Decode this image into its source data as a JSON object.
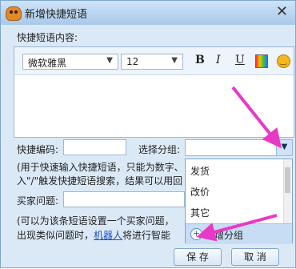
{
  "window": {
    "title": "新增快捷短语"
  },
  "labels": {
    "content": "快捷短语内容:",
    "code": "快捷编码:",
    "group": "选择分组:",
    "hint1_line1": "(用于快速输入快捷短语，只能为数字、",
    "hint1_line2": "入\"/\"触发快捷短语搜索，结果可以用回",
    "question": "买家问题:",
    "hint2_line1": "(可以为该条短语设置一个买家问题，",
    "hint2_line2a": "出现类似问题时，",
    "hint2_link": "机器人",
    "hint2_line2b": "将进行智能"
  },
  "toolbar": {
    "font": "微软雅黑",
    "size": "12",
    "bold": "B",
    "italic": "I",
    "underline": "U"
  },
  "dropdown": {
    "options": [
      "发货",
      "改价",
      "其它"
    ],
    "new_group": "新增分组"
  },
  "buttons": {
    "save": "保 存",
    "cancel": "取 消"
  },
  "colors": {
    "accent": "#e838c8",
    "titlebar": "#a9c9ea"
  }
}
